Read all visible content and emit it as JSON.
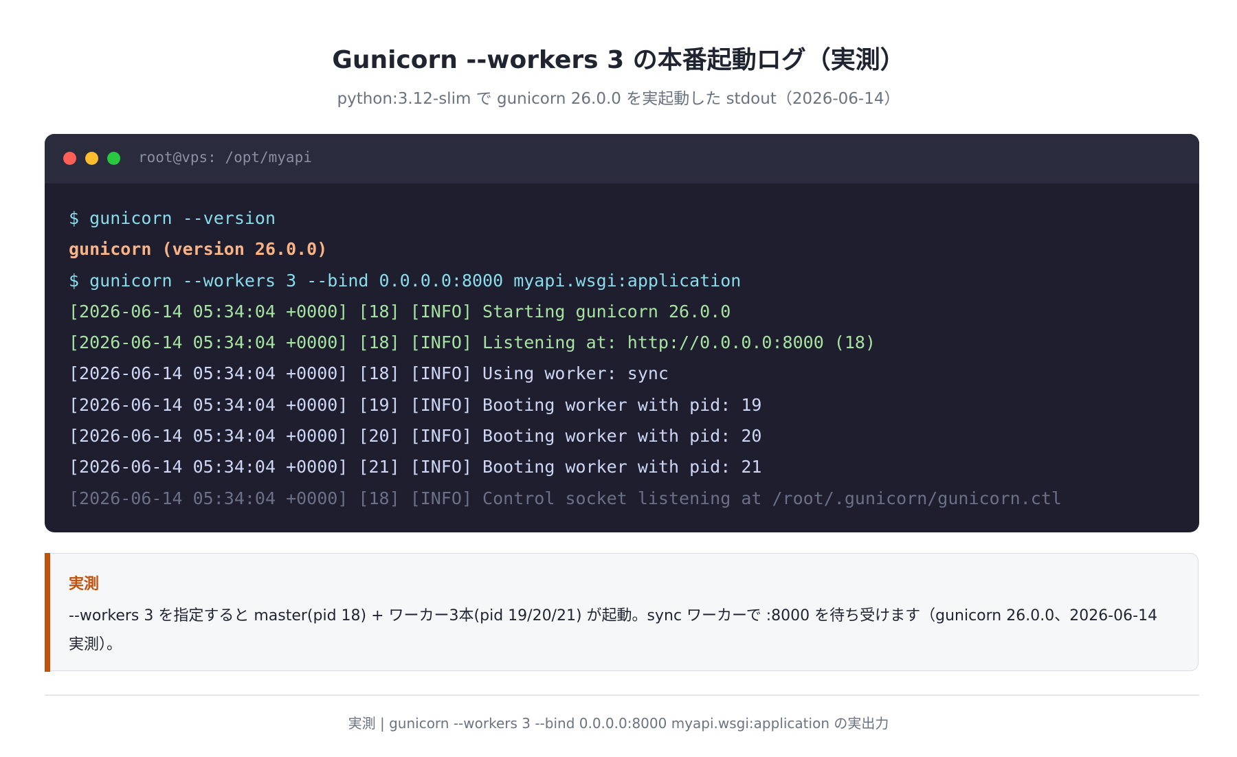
{
  "header": {
    "title": "Gunicorn --workers 3 の本番起動ログ（実測）",
    "subtitle": "python:3.12-slim で gunicorn 26.0.0 を実起動した stdout（2026-06-14）"
  },
  "terminal": {
    "window_title": "root@vps: /opt/myapi",
    "lines": [
      "$ gunicorn --version",
      "gunicorn (version 26.0.0)",
      "$ gunicorn --workers 3 --bind 0.0.0.0:8000 myapi.wsgi:application",
      "[2026-06-14 05:34:04 +0000] [18] [INFO] Starting gunicorn 26.0.0",
      "[2026-06-14 05:34:04 +0000] [18] [INFO] Listening at: http://0.0.0.0:8000 (18)",
      "[2026-06-14 05:34:04 +0000] [18] [INFO] Using worker: sync",
      "[2026-06-14 05:34:04 +0000] [19] [INFO] Booting worker with pid: 19",
      "[2026-06-14 05:34:04 +0000] [20] [INFO] Booting worker with pid: 20",
      "[2026-06-14 05:34:04 +0000] [21] [INFO] Booting worker with pid: 21",
      "[2026-06-14 05:34:04 +0000] [18] [INFO] Control socket listening at /root/.gunicorn/gunicorn.ctl"
    ]
  },
  "callout": {
    "label": "実測",
    "text": "--workers 3 を指定すると master(pid 18) + ワーカー3本(pid 19/20/21) が起動。sync ワーカーで :8000 を待ち受けます（gunicorn 26.0.0、2026-06-14 実測）。"
  },
  "footer": {
    "text": "実測 | gunicorn --workers 3 --bind 0.0.0.0:8000 myapi.wsgi:application の実出力"
  },
  "colors": {
    "accent": "#c2510c",
    "terminal_bg": "#1e1e2e",
    "command": "#89dceb",
    "version": "#fab387",
    "info_green": "#a6e3a1",
    "dim": "#6c7086"
  }
}
